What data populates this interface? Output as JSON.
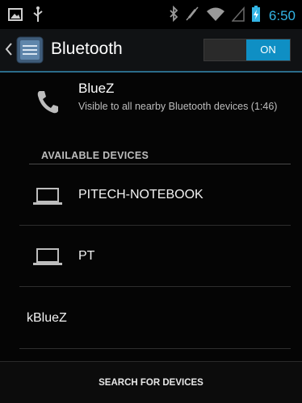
{
  "statusbar": {
    "time": "6:50"
  },
  "actionbar": {
    "title": "Bluetooth",
    "toggle_label": "ON"
  },
  "local_device": {
    "name": "BlueZ",
    "subtitle": "Visible to all nearby Bluetooth devices (1:46)"
  },
  "available": {
    "header": "AVAILABLE DEVICES",
    "devices": [
      {
        "name": "PITECH-NOTEBOOK",
        "icon": "laptop-icon"
      },
      {
        "name": "PT",
        "icon": "laptop-icon"
      },
      {
        "name": "kBlueZ",
        "icon": ""
      }
    ]
  },
  "bottom": {
    "search_label": "SEARCH FOR DEVICES"
  },
  "colors": {
    "accent": "#33b5e5",
    "toggle_on": "#0f8fc4"
  }
}
